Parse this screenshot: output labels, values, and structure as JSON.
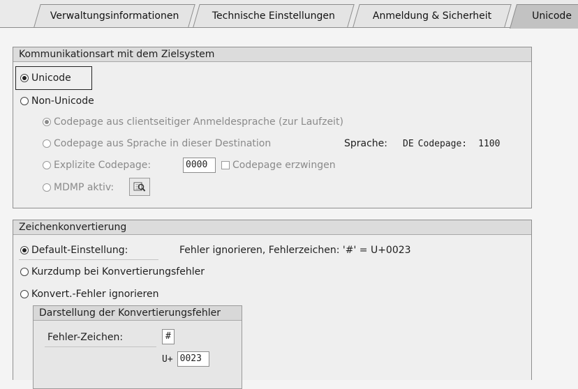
{
  "tabs": [
    {
      "label": "Verwaltungsinformationen"
    },
    {
      "label": "Technische Einstellungen"
    },
    {
      "label": "Anmeldung & Sicherheit"
    },
    {
      "label": "Unicode"
    }
  ],
  "comm": {
    "title": "Kommunikationsart mit dem Zielsystem",
    "unicode": "Unicode",
    "non_unicode": "Non-Unicode",
    "cp_client": "Codepage aus clientseitiger Anmeldesprache (zur Laufzeit)",
    "cp_dest": "Codepage aus Sprache in dieser Destination",
    "sprache_label": "Sprache:",
    "sprache_value": "DE",
    "codepage_label": "Codepage:",
    "codepage_value": "1100",
    "explicit_cp": "Explizite Codepage:",
    "explicit_cp_value": "0000",
    "force_cp": "Codepage erzwingen",
    "mdmp": "MDMP aktiv:"
  },
  "conv": {
    "title": "Zeichenkonvertierung",
    "default": "Default-Einstellung:",
    "default_desc": "Fehler ignorieren, Fehlerzeichen: '#' = U+0023",
    "dump": "Kurzdump bei Konvertierungsfehler",
    "ignore": "Konvert.-Fehler ignorieren",
    "sub_title": "Darstellung der Konvertierungsfehler",
    "err_char_label": "Fehler-Zeichen:",
    "err_char_value": "#",
    "uplus_label": "U+",
    "uplus_value": "0023"
  },
  "icons": {
    "mdmp_button": "magnifier-list-icon"
  }
}
